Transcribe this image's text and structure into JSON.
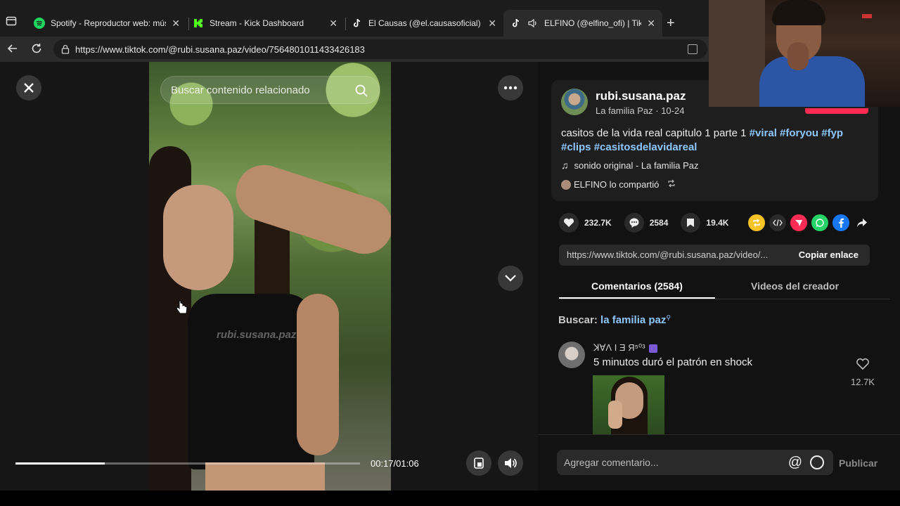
{
  "browser": {
    "tabs": [
      {
        "title": "Spotify - Reproductor web: músic",
        "icon": "spotify-icon",
        "active": false
      },
      {
        "title": "Stream - Kick Dashboard",
        "icon": "kick-icon",
        "active": false
      },
      {
        "title": "El Causas (@el.causasoficial) | Tik",
        "icon": "tiktok-icon",
        "active": false
      },
      {
        "title": "ELFINO (@elfino_ofi) | TikTok",
        "icon": "tiktok-icon",
        "active": true
      }
    ],
    "close_glyph": "✕",
    "new_tab_glyph": "+",
    "url": "https://www.tiktok.com/@rubi.susana.paz/video/7564801011433426183"
  },
  "video": {
    "search_placeholder": "Buscar contenido relacionado",
    "watermark": "rubi.susana.paz",
    "current_time": "00:17",
    "duration": "01:06",
    "time_display": "00:17/01:06",
    "progress_fraction": 0.26
  },
  "post": {
    "author": "rubi.susana.paz",
    "author_sub": "La familia Paz · 10-24",
    "caption": "casitos de la vida real capitulo 1 parte 1",
    "hashtags": [
      "#viral",
      "#foryou",
      "#fyp",
      "#clips",
      "#casitosdelavidareal"
    ],
    "music": "sonido original - La familia Paz",
    "shared_by": "ELFINO lo compartió",
    "likes": "232.7K",
    "comments": "2584",
    "saves": "19.4K",
    "share_link": "https://www.tiktok.com/@rubi.susana.paz/video/...",
    "copy_label": "Copiar enlace"
  },
  "tabs": {
    "comments_label": "Comentarios (2584)",
    "creator_videos_label": "Videos del creador"
  },
  "search_suggest": {
    "prefix": "Buscar:",
    "query": "la familia paz"
  },
  "comment": {
    "user": "ꓘ∀Ʌ I Ǝ Я⁵⁰³",
    "text": "5 minutos duró el patrón en shock",
    "likes": "12.7K"
  },
  "composer": {
    "placeholder": "Agregar comentario...",
    "at_glyph": "@",
    "publish_label": "Publicar"
  },
  "colors": {
    "accent": "#fe2c55",
    "hashtag": "#8ec7ff",
    "panel_bg": "#121212"
  }
}
